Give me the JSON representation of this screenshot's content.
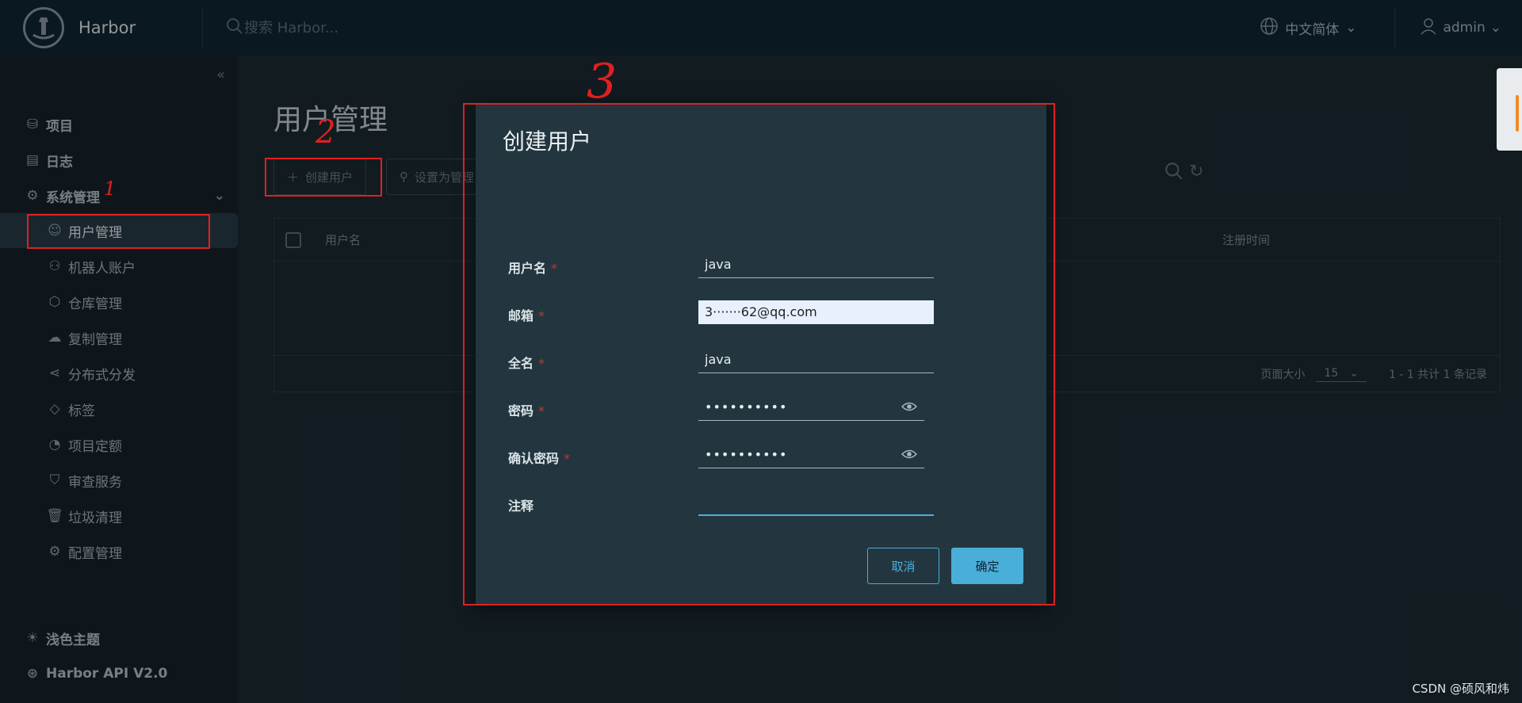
{
  "header": {
    "app_title": "Harbor",
    "search_placeholder": "搜索 Harbor...",
    "language": "中文简体",
    "username": "admin"
  },
  "sidebar": {
    "items": [
      {
        "label": "项目",
        "icon": "projects-icon"
      },
      {
        "label": "日志",
        "icon": "logs-icon"
      },
      {
        "label": "系统管理",
        "icon": "admin-icon"
      },
      {
        "label": "用户管理",
        "icon": "users-icon"
      },
      {
        "label": "机器人账户",
        "icon": "robot-icon"
      },
      {
        "label": "仓库管理",
        "icon": "registry-icon"
      },
      {
        "label": "复制管理",
        "icon": "replication-icon"
      },
      {
        "label": "分布式分发",
        "icon": "distribution-icon"
      },
      {
        "label": "标签",
        "icon": "tag-icon"
      },
      {
        "label": "项目定额",
        "icon": "quota-icon"
      },
      {
        "label": "审查服务",
        "icon": "shield-icon"
      },
      {
        "label": "垃圾清理",
        "icon": "trash-icon"
      },
      {
        "label": "配置管理",
        "icon": "gear-icon"
      }
    ],
    "theme_toggle": "浅色主题",
    "api_link": "Harbor API V2.0"
  },
  "main": {
    "page_title": "用户管理",
    "create_user_button": "创建用户",
    "set_admin_button": "设置为管理",
    "table": {
      "col_username": "用户名",
      "col_registered": "注册时间"
    },
    "pagination": {
      "page_size_label": "页面大小",
      "page_size": "15",
      "summary": "1 - 1 共计 1 条记录"
    }
  },
  "dialog": {
    "title": "创建用户",
    "required_mark": "*",
    "fields": {
      "username": {
        "label": "用户名",
        "value": "java"
      },
      "email": {
        "label": "邮箱",
        "value": "3·······62@qq.com"
      },
      "fullname": {
        "label": "全名",
        "value": "java"
      },
      "password": {
        "label": "密码",
        "value": "••••••••••"
      },
      "confirm_password": {
        "label": "确认密码",
        "value": "••••••••••"
      },
      "comment": {
        "label": "注释",
        "value": ""
      }
    },
    "cancel_button": "取消",
    "ok_button": "确定"
  },
  "annotations": {
    "step1": "1",
    "step2": "2",
    "step3": "3",
    "color": "#e02020"
  },
  "watermark": "CSDN @硕风和炜",
  "colors": {
    "header_bg": "#0f2533",
    "sidebar_bg": "#16232b",
    "modal_bg": "#23363f",
    "accent": "#49afd9"
  }
}
